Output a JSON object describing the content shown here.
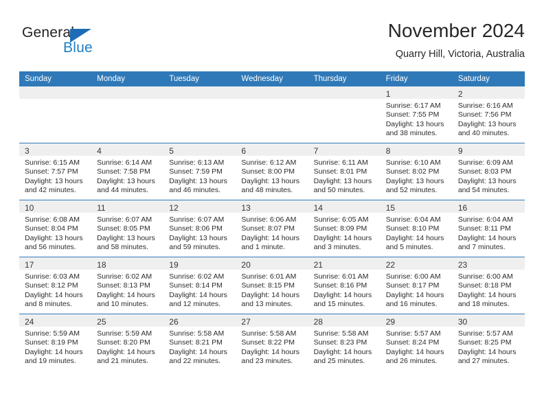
{
  "brand": {
    "name_part1": "General",
    "name_part2": "Blue",
    "triangle_color": "#1e6cb5",
    "blue_color": "#1e7fc4"
  },
  "header": {
    "title": "November 2024",
    "subtitle": "Quarry Hill, Victoria, Australia"
  },
  "theme": {
    "header_bg": "#3079b8",
    "daynum_bg": "#efefef",
    "grid_line": "#3079b8",
    "text": "#2b2b2b"
  },
  "weekdays": [
    "Sunday",
    "Monday",
    "Tuesday",
    "Wednesday",
    "Thursday",
    "Friday",
    "Saturday"
  ],
  "weeks": [
    [
      {
        "empty": true
      },
      {
        "empty": true
      },
      {
        "empty": true
      },
      {
        "empty": true
      },
      {
        "empty": true
      },
      {
        "day": "1",
        "sunrise": "Sunrise: 6:17 AM",
        "sunset": "Sunset: 7:55 PM",
        "daylight1": "Daylight: 13 hours",
        "daylight2": "and 38 minutes."
      },
      {
        "day": "2",
        "sunrise": "Sunrise: 6:16 AM",
        "sunset": "Sunset: 7:56 PM",
        "daylight1": "Daylight: 13 hours",
        "daylight2": "and 40 minutes."
      }
    ],
    [
      {
        "day": "3",
        "sunrise": "Sunrise: 6:15 AM",
        "sunset": "Sunset: 7:57 PM",
        "daylight1": "Daylight: 13 hours",
        "daylight2": "and 42 minutes."
      },
      {
        "day": "4",
        "sunrise": "Sunrise: 6:14 AM",
        "sunset": "Sunset: 7:58 PM",
        "daylight1": "Daylight: 13 hours",
        "daylight2": "and 44 minutes."
      },
      {
        "day": "5",
        "sunrise": "Sunrise: 6:13 AM",
        "sunset": "Sunset: 7:59 PM",
        "daylight1": "Daylight: 13 hours",
        "daylight2": "and 46 minutes."
      },
      {
        "day": "6",
        "sunrise": "Sunrise: 6:12 AM",
        "sunset": "Sunset: 8:00 PM",
        "daylight1": "Daylight: 13 hours",
        "daylight2": "and 48 minutes."
      },
      {
        "day": "7",
        "sunrise": "Sunrise: 6:11 AM",
        "sunset": "Sunset: 8:01 PM",
        "daylight1": "Daylight: 13 hours",
        "daylight2": "and 50 minutes."
      },
      {
        "day": "8",
        "sunrise": "Sunrise: 6:10 AM",
        "sunset": "Sunset: 8:02 PM",
        "daylight1": "Daylight: 13 hours",
        "daylight2": "and 52 minutes."
      },
      {
        "day": "9",
        "sunrise": "Sunrise: 6:09 AM",
        "sunset": "Sunset: 8:03 PM",
        "daylight1": "Daylight: 13 hours",
        "daylight2": "and 54 minutes."
      }
    ],
    [
      {
        "day": "10",
        "sunrise": "Sunrise: 6:08 AM",
        "sunset": "Sunset: 8:04 PM",
        "daylight1": "Daylight: 13 hours",
        "daylight2": "and 56 minutes."
      },
      {
        "day": "11",
        "sunrise": "Sunrise: 6:07 AM",
        "sunset": "Sunset: 8:05 PM",
        "daylight1": "Daylight: 13 hours",
        "daylight2": "and 58 minutes."
      },
      {
        "day": "12",
        "sunrise": "Sunrise: 6:07 AM",
        "sunset": "Sunset: 8:06 PM",
        "daylight1": "Daylight: 13 hours",
        "daylight2": "and 59 minutes."
      },
      {
        "day": "13",
        "sunrise": "Sunrise: 6:06 AM",
        "sunset": "Sunset: 8:07 PM",
        "daylight1": "Daylight: 14 hours",
        "daylight2": "and 1 minute."
      },
      {
        "day": "14",
        "sunrise": "Sunrise: 6:05 AM",
        "sunset": "Sunset: 8:09 PM",
        "daylight1": "Daylight: 14 hours",
        "daylight2": "and 3 minutes."
      },
      {
        "day": "15",
        "sunrise": "Sunrise: 6:04 AM",
        "sunset": "Sunset: 8:10 PM",
        "daylight1": "Daylight: 14 hours",
        "daylight2": "and 5 minutes."
      },
      {
        "day": "16",
        "sunrise": "Sunrise: 6:04 AM",
        "sunset": "Sunset: 8:11 PM",
        "daylight1": "Daylight: 14 hours",
        "daylight2": "and 7 minutes."
      }
    ],
    [
      {
        "day": "17",
        "sunrise": "Sunrise: 6:03 AM",
        "sunset": "Sunset: 8:12 PM",
        "daylight1": "Daylight: 14 hours",
        "daylight2": "and 8 minutes."
      },
      {
        "day": "18",
        "sunrise": "Sunrise: 6:02 AM",
        "sunset": "Sunset: 8:13 PM",
        "daylight1": "Daylight: 14 hours",
        "daylight2": "and 10 minutes."
      },
      {
        "day": "19",
        "sunrise": "Sunrise: 6:02 AM",
        "sunset": "Sunset: 8:14 PM",
        "daylight1": "Daylight: 14 hours",
        "daylight2": "and 12 minutes."
      },
      {
        "day": "20",
        "sunrise": "Sunrise: 6:01 AM",
        "sunset": "Sunset: 8:15 PM",
        "daylight1": "Daylight: 14 hours",
        "daylight2": "and 13 minutes."
      },
      {
        "day": "21",
        "sunrise": "Sunrise: 6:01 AM",
        "sunset": "Sunset: 8:16 PM",
        "daylight1": "Daylight: 14 hours",
        "daylight2": "and 15 minutes."
      },
      {
        "day": "22",
        "sunrise": "Sunrise: 6:00 AM",
        "sunset": "Sunset: 8:17 PM",
        "daylight1": "Daylight: 14 hours",
        "daylight2": "and 16 minutes."
      },
      {
        "day": "23",
        "sunrise": "Sunrise: 6:00 AM",
        "sunset": "Sunset: 8:18 PM",
        "daylight1": "Daylight: 14 hours",
        "daylight2": "and 18 minutes."
      }
    ],
    [
      {
        "day": "24",
        "sunrise": "Sunrise: 5:59 AM",
        "sunset": "Sunset: 8:19 PM",
        "daylight1": "Daylight: 14 hours",
        "daylight2": "and 19 minutes."
      },
      {
        "day": "25",
        "sunrise": "Sunrise: 5:59 AM",
        "sunset": "Sunset: 8:20 PM",
        "daylight1": "Daylight: 14 hours",
        "daylight2": "and 21 minutes."
      },
      {
        "day": "26",
        "sunrise": "Sunrise: 5:58 AM",
        "sunset": "Sunset: 8:21 PM",
        "daylight1": "Daylight: 14 hours",
        "daylight2": "and 22 minutes."
      },
      {
        "day": "27",
        "sunrise": "Sunrise: 5:58 AM",
        "sunset": "Sunset: 8:22 PM",
        "daylight1": "Daylight: 14 hours",
        "daylight2": "and 23 minutes."
      },
      {
        "day": "28",
        "sunrise": "Sunrise: 5:58 AM",
        "sunset": "Sunset: 8:23 PM",
        "daylight1": "Daylight: 14 hours",
        "daylight2": "and 25 minutes."
      },
      {
        "day": "29",
        "sunrise": "Sunrise: 5:57 AM",
        "sunset": "Sunset: 8:24 PM",
        "daylight1": "Daylight: 14 hours",
        "daylight2": "and 26 minutes."
      },
      {
        "day": "30",
        "sunrise": "Sunrise: 5:57 AM",
        "sunset": "Sunset: 8:25 PM",
        "daylight1": "Daylight: 14 hours",
        "daylight2": "and 27 minutes."
      }
    ]
  ]
}
